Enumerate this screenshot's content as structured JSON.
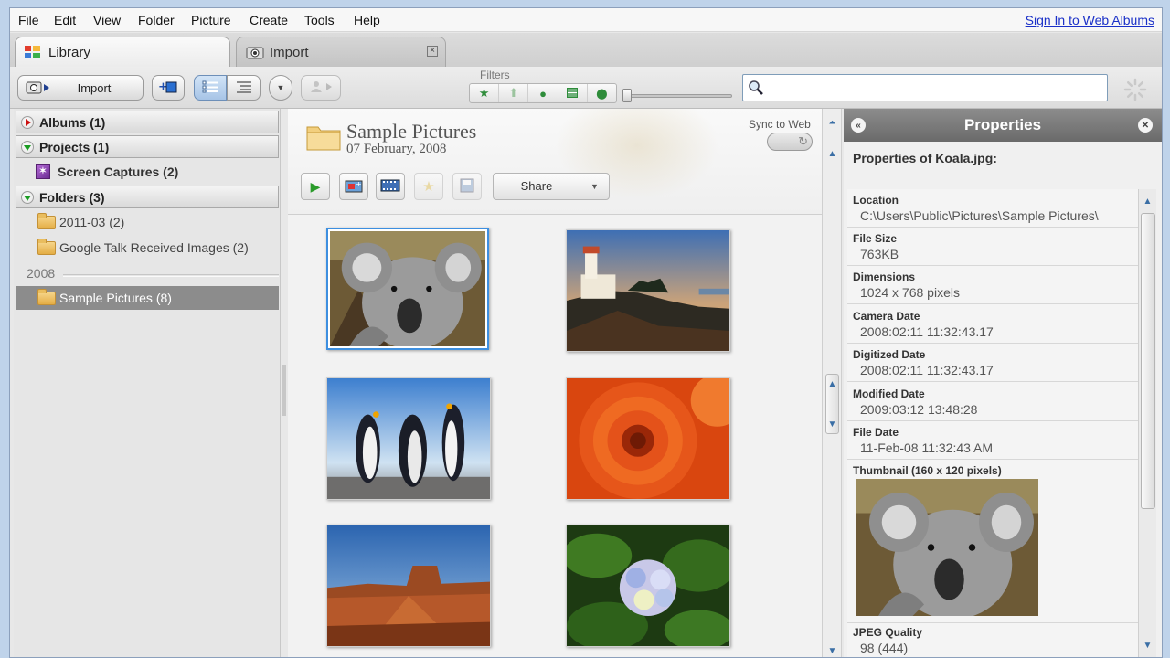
{
  "menubar": {
    "items": [
      "File",
      "Edit",
      "View",
      "Folder",
      "Picture",
      "Create",
      "Tools",
      "Help"
    ],
    "sign_in": "Sign In to Web Albums"
  },
  "tabs": [
    {
      "label": "Library",
      "active": true
    },
    {
      "label": "Import",
      "active": false
    }
  ],
  "toolbar": {
    "import_label": "Import",
    "filters_label": "Filters",
    "search_placeholder": ""
  },
  "left_panel": {
    "albums": "Albums (1)",
    "projects": "Projects (1)",
    "screen_captures": "Screen Captures (2)",
    "folders": "Folders (3)",
    "folder_items": [
      "2011-03 (2)",
      "Google Talk Received Images (2)"
    ],
    "year": "2008",
    "selected_folder": "Sample Pictures (8)"
  },
  "center": {
    "title": "Sample Pictures",
    "date": "07 February, 2008",
    "sync_label": "Sync to Web",
    "share_label": "Share",
    "thumbnails": [
      "koala",
      "lighthouse",
      "penguins",
      "chrysanthemum",
      "desert",
      "hydrangeas"
    ]
  },
  "properties": {
    "header": "Properties",
    "subtitle": "Properties of Koala.jpg:",
    "rows": [
      {
        "key": "Location",
        "value": "C:\\Users\\Public\\Pictures\\Sample Pictures\\"
      },
      {
        "key": "File Size",
        "value": "763KB"
      },
      {
        "key": "Dimensions",
        "value": "1024 x 768 pixels"
      },
      {
        "key": "Camera Date",
        "value": "2008:02:11 11:32:43.17"
      },
      {
        "key": "Digitized Date",
        "value": "2008:02:11 11:32:43.17"
      },
      {
        "key": "Modified Date",
        "value": "2009:03:12 13:48:28"
      },
      {
        "key": "File Date",
        "value": "11-Feb-08 11:32:43 AM"
      }
    ],
    "thumbnail_label": "Thumbnail (160 x 120 pixels)",
    "jpeg_quality_label": "JPEG Quality",
    "jpeg_quality_value": "98 (444)"
  },
  "colors": {
    "accent": "#3d8fe0",
    "selection": "#8c8c8c",
    "link": "#1a30c8"
  }
}
